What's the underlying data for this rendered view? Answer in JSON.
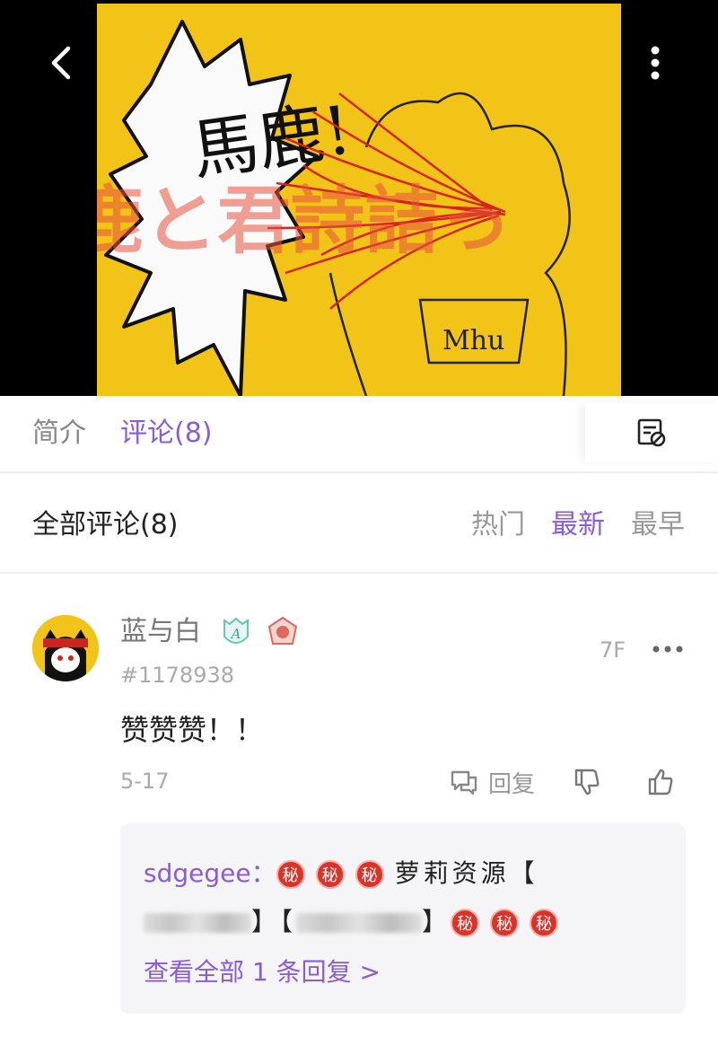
{
  "colors": {
    "accent": "#8a5cd6",
    "cover_bg": "#f2c418",
    "secret_badge": "#d9342b"
  },
  "cover": {
    "overlay_title": "鹿と君詩詰っ",
    "bubble_text": "馬鹿!",
    "shirt_text": "Mhu",
    "back_icon": "chevron-left-icon",
    "more_icon": "vertical-dots-icon"
  },
  "tabs": {
    "intro": "简介",
    "comments": "评论(8)",
    "action_icon": "danmaku-off-icon"
  },
  "comments_header": {
    "title": "全部评论(8)",
    "sort_hot": "热门",
    "sort_new": "最新",
    "sort_early": "最早"
  },
  "comment": {
    "username": "蓝与白",
    "uid": "#1178938",
    "floor": "7F",
    "text": "赞赞赞！！",
    "date": "5-17",
    "reply_label": "回复",
    "reply": {
      "author": "sdgegee：",
      "secret_mark": "秘",
      "body": "萝莉资源【",
      "bracket_mid": "】【",
      "bracket_end": "】",
      "view_all": "查看全部 1 条回复 >"
    }
  }
}
